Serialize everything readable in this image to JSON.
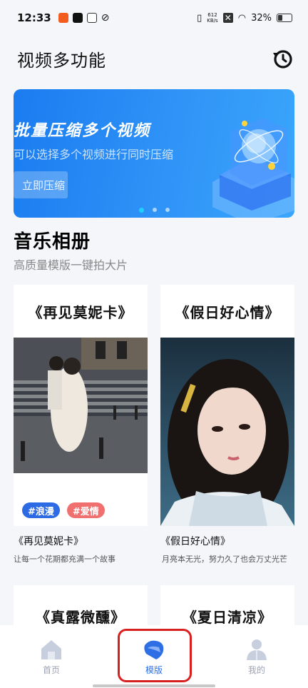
{
  "status_bar": {
    "time": "12:33",
    "net_speed_value": "612",
    "net_speed_unit": "KB/s",
    "battery": "32%",
    "battery_level": 0.32
  },
  "header": {
    "title": "视频多功能",
    "history_icon": "history-clock-icon"
  },
  "banner": {
    "title": "批量压缩多个视频",
    "subtitle": "可以选择多个视频进行同时压缩",
    "button_label": "立即压缩",
    "active_dot": 0,
    "dot_count": 3
  },
  "section": {
    "title": "音乐相册",
    "subtitle": "高质量模版一键拍大片"
  },
  "cards": [
    {
      "heading": "《再见莫妮卡》",
      "tags": [
        {
          "label": "#浪漫",
          "color": "#2d6be4"
        },
        {
          "label": "#爱情",
          "color": "#f07070"
        }
      ],
      "name": "《再见莫妮卡》",
      "desc": "让每一个花期都充满一个故事"
    },
    {
      "heading": "《假日好心情》",
      "tags": [],
      "name": "《假日好心情》",
      "desc": "月亮本无光，努力久了也会万丈光芒"
    },
    {
      "heading": "《真露微醺》"
    },
    {
      "heading": "《夏日清凉》"
    }
  ],
  "bottom_nav": {
    "items": [
      {
        "label": "首页",
        "icon": "home-icon",
        "active": false
      },
      {
        "label": "模版",
        "icon": "template-icon",
        "active": true
      },
      {
        "label": "我的",
        "icon": "profile-icon",
        "active": false
      }
    ]
  },
  "colors": {
    "accent": "#2f6fe6",
    "banner": "#1a7cf0",
    "highlight": "#d92020"
  }
}
